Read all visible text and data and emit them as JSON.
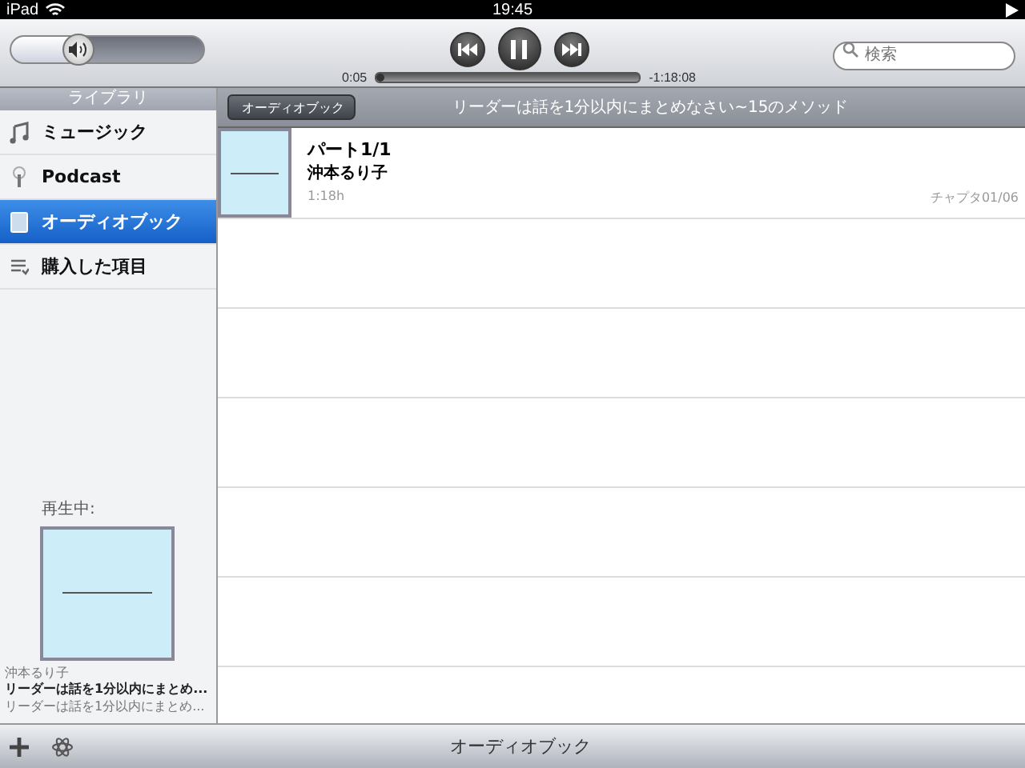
{
  "status_bar": {
    "device": "iPad",
    "time": "19:45",
    "playing": true
  },
  "player": {
    "volume": {
      "level": 0.36
    },
    "playing": true,
    "elapsed": "0:05",
    "remaining": "-1:18:08",
    "progress": {
      "level": 0.01
    },
    "search": {
      "placeholder": "検索"
    }
  },
  "sidebar": {
    "title": "ライブラリ",
    "items": [
      {
        "label": "ミュージック",
        "kind": "music",
        "selected": false
      },
      {
        "label": "Podcast",
        "kind": "podcast",
        "selected": false
      },
      {
        "label": "オーディオブック",
        "kind": "audiobook",
        "selected": true
      },
      {
        "label": "購入した項目",
        "kind": "purchased",
        "selected": false
      }
    ],
    "now_playing": {
      "heading": "再生中:",
      "artist": "沖本るり子",
      "title": "リーダーは話を1分以内にまとめ...",
      "album": "リーダーは話を1分以内にまとめ..."
    }
  },
  "header": {
    "back": "オーディオブック",
    "title": "リーダーは話を1分以内にまとめなさい~15のメソッド"
  },
  "tracks": [
    {
      "title": "パート1/1",
      "author": "沖本るり子",
      "duration": "1:18h",
      "chapter": "チャプタ01/06"
    }
  ],
  "bottom_bar": {
    "title": "オーディオブック"
  }
}
